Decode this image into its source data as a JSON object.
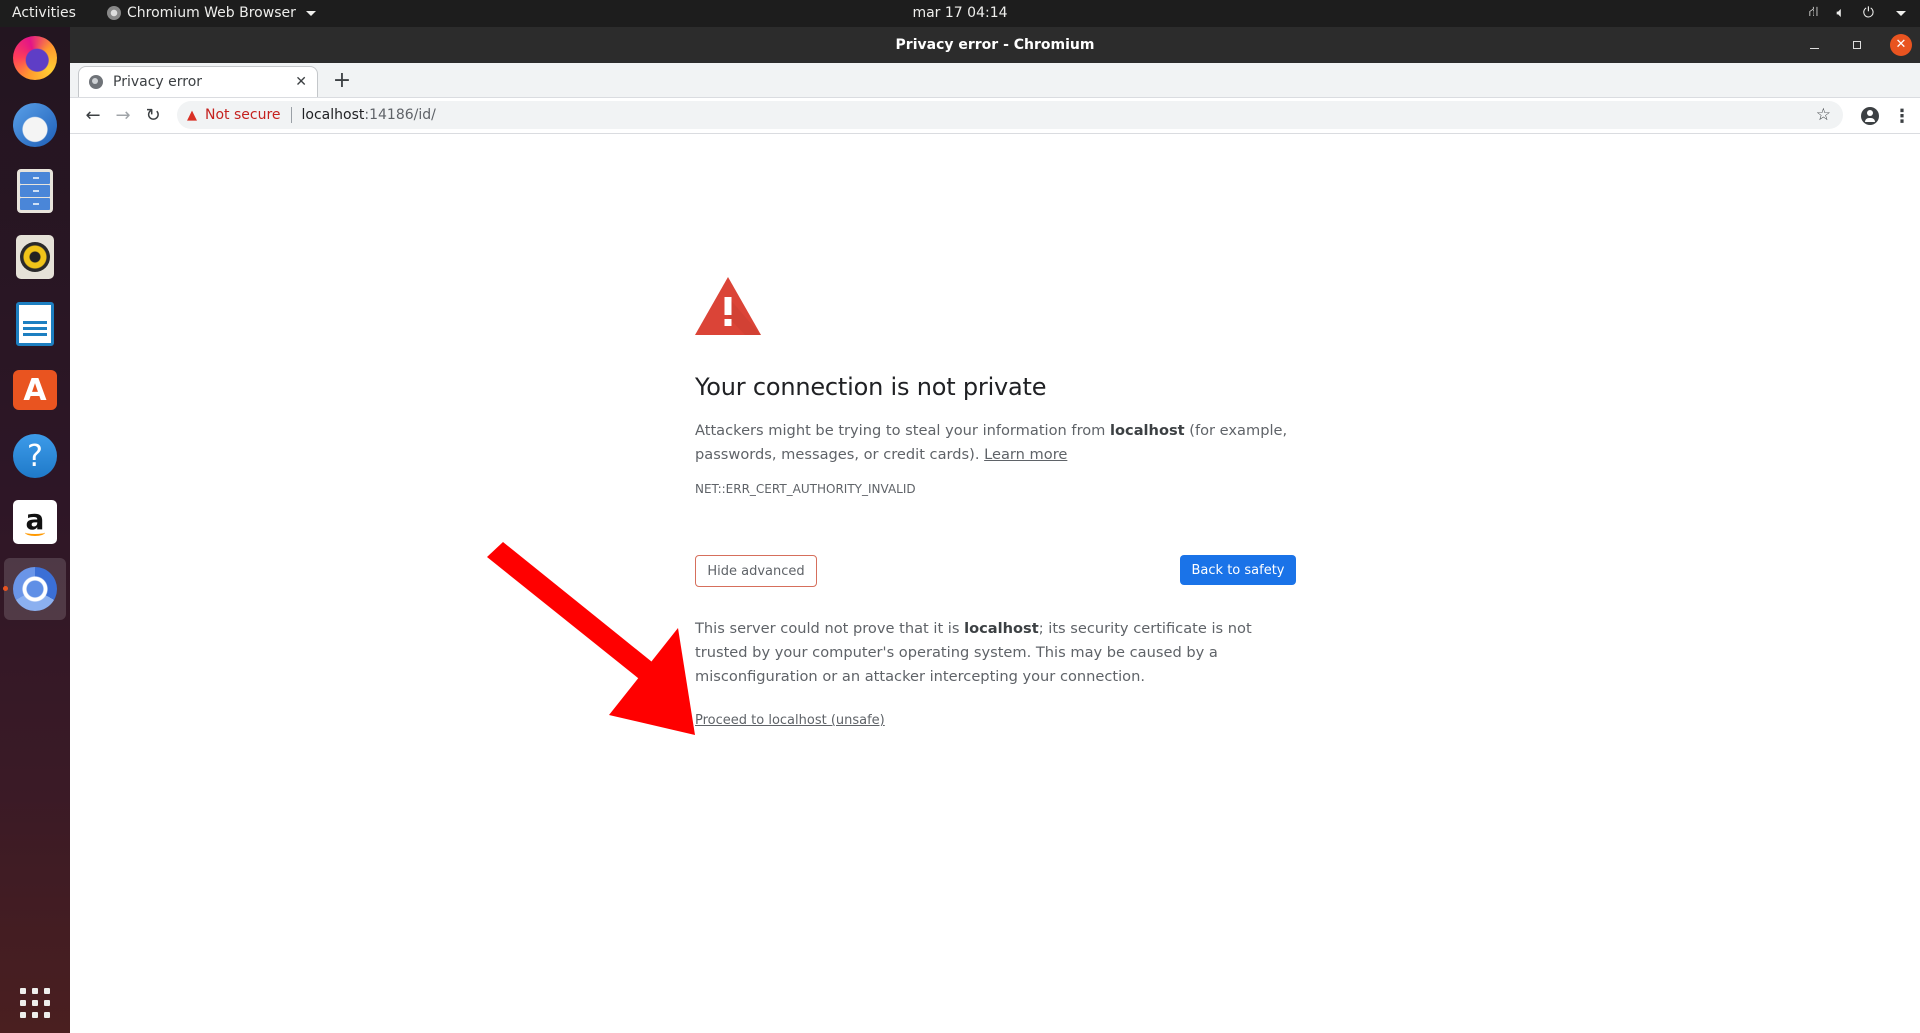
{
  "system_bar": {
    "activities": "Activities",
    "app_menu": "Chromium Web Browser",
    "clock": "mar 17  04:14",
    "tray_icons": [
      "network-icon",
      "volume-icon",
      "power-icon"
    ]
  },
  "dock": {
    "items": [
      {
        "name": "Firefox",
        "icon": "firefox-icon"
      },
      {
        "name": "Thunderbird",
        "icon": "thunderbird-icon"
      },
      {
        "name": "Files",
        "icon": "files-icon"
      },
      {
        "name": "Rhythmbox",
        "icon": "rhythmbox-icon"
      },
      {
        "name": "LibreOffice Writer",
        "icon": "writer-icon"
      },
      {
        "name": "Ubuntu Software",
        "icon": "software-icon",
        "glyph": "A"
      },
      {
        "name": "Help",
        "icon": "help-icon",
        "glyph": "?"
      },
      {
        "name": "Amazon",
        "icon": "amazon-icon",
        "glyph": "a"
      },
      {
        "name": "Chromium",
        "icon": "chromium-icon",
        "active": true
      }
    ],
    "show_apps": "show-applications-icon"
  },
  "window": {
    "title": "Privacy error - Chromium",
    "close_glyph": "✕"
  },
  "tabs": [
    {
      "title": "Privacy error",
      "active": true,
      "close_glyph": "✕"
    }
  ],
  "new_tab_glyph": "+",
  "toolbar": {
    "back_glyph": "←",
    "forward_glyph": "→",
    "reload_glyph": "↻",
    "security_label": "Not secure",
    "url_host": "localhost",
    "url_rest": ":14186/id/",
    "star_glyph": "☆",
    "menu_glyph": "⋮"
  },
  "interstitial": {
    "heading": "Your connection is not private",
    "para_part1": "Attackers might be trying to steal your information from ",
    "para_host": "localhost",
    "para_part2": " (for example, passwords, messages, or credit cards). ",
    "learn_more": "Learn more",
    "error_code": "NET::ERR_CERT_AUTHORITY_INVALID",
    "hide_advanced": "Hide advanced",
    "back_to_safety": "Back to safety",
    "adv_part1": "This server could not prove that it is ",
    "adv_host": "localhost",
    "adv_part2": "; its security certificate is not trusted by your computer's operating system. This may be caused by a misconfiguration or an attacker intercepting your connection.",
    "proceed_link": "Proceed to localhost (unsafe)"
  },
  "annotation": {
    "type": "red-arrow",
    "points_to": "Proceed to localhost (unsafe)",
    "color": "#ff0000"
  },
  "colors": {
    "accent_blue": "#1a73e8",
    "warning_red": "#d93025",
    "ubuntu_orange": "#e95420"
  }
}
